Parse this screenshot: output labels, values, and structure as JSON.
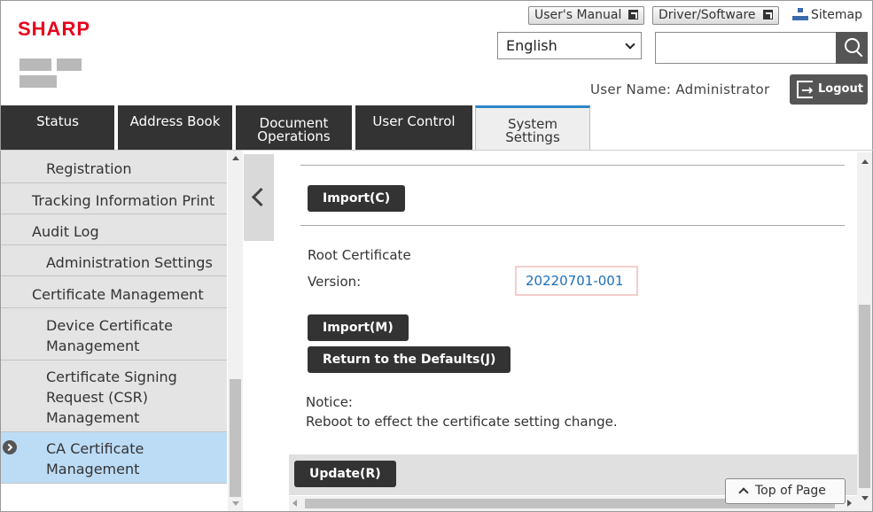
{
  "header": {
    "brand": "SHARP",
    "users_manual": "User's Manual",
    "driver_software": "Driver/Software",
    "sitemap": "Sitemap",
    "language": "English",
    "search_placeholder": "",
    "user_name": "User Name: Administrator",
    "logout": "Logout"
  },
  "tabs": [
    {
      "label_line1": "Status",
      "label_line2": ""
    },
    {
      "label_line1": "Address Book",
      "label_line2": ""
    },
    {
      "label_line1": "Document",
      "label_line2": "Operations"
    },
    {
      "label_line1": "User Control",
      "label_line2": ""
    },
    {
      "label_line1": "System",
      "label_line2": "Settings"
    }
  ],
  "sidebar": {
    "items": [
      {
        "lines": [
          "Registration"
        ]
      },
      {
        "lines": [
          "Tracking Information Print"
        ]
      },
      {
        "lines": [
          "Audit Log"
        ]
      },
      {
        "lines": [
          "Administration Settings"
        ]
      },
      {
        "lines": [
          "Certificate Management"
        ]
      },
      {
        "lines": [
          "Device Certificate",
          "Management"
        ]
      },
      {
        "lines": [
          "Certificate Signing",
          "Request (CSR)",
          "Management"
        ]
      },
      {
        "lines": [
          "CA Certificate",
          "Management"
        ]
      }
    ]
  },
  "main": {
    "import_c": "Import(C)",
    "root_certificate": "Root Certificate",
    "version_label": "Version:",
    "version_value": "20220701-001",
    "import_m": "Import(M)",
    "return_defaults": "Return to the Defaults(J)",
    "notice_label": "Notice:",
    "notice_text": "Reboot to effect the certificate setting change.",
    "update": "Update(R)",
    "top_of_page": "Top of Page"
  },
  "colors": {
    "brand": "#e8001c",
    "tab_dark": "#333333",
    "tab_active_accent": "#2b86c6",
    "selected_item": "#bcdcf6",
    "link": "#1a6fb8"
  }
}
